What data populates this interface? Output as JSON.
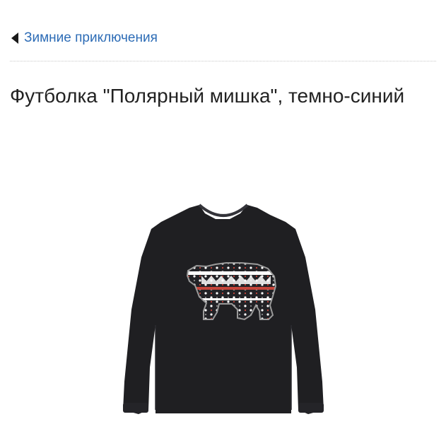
{
  "breadcrumb": {
    "label": "Зимние приключения",
    "icon": "back-arrow-icon",
    "color": "#2d6cb6"
  },
  "product": {
    "title": "Футболка \"Полярный мишка\", темно-синий",
    "image": {
      "subject": "long-sleeve-tshirt",
      "garment_color": "#1f1f22",
      "print_colors": [
        "#ffffff",
        "#c6463b",
        "#8c8c8c"
      ]
    }
  }
}
